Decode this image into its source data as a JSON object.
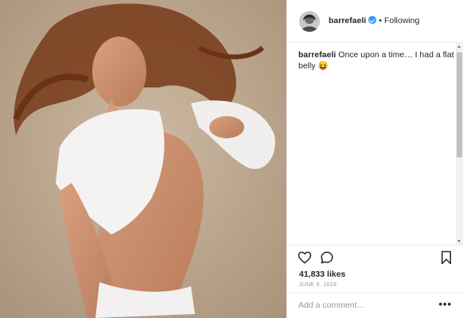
{
  "post": {
    "username": "barrefaeli",
    "separator": "•",
    "follow_status": "Following",
    "caption_text": "Once upon a time… I had a flat belly 😝",
    "likes": "41,833 likes",
    "date": "JUNE 6, 2018",
    "comment_placeholder": "Add a comment...",
    "more_label": "•••"
  },
  "icons": {
    "verified": "verified-badge-icon",
    "like": "heart-icon",
    "comment": "comment-bubble-icon",
    "save": "bookmark-icon",
    "more": "more-options-icon"
  },
  "colors": {
    "verified_blue": "#3897f0",
    "text": "#262626",
    "muted": "#999999",
    "border": "#efefef"
  }
}
